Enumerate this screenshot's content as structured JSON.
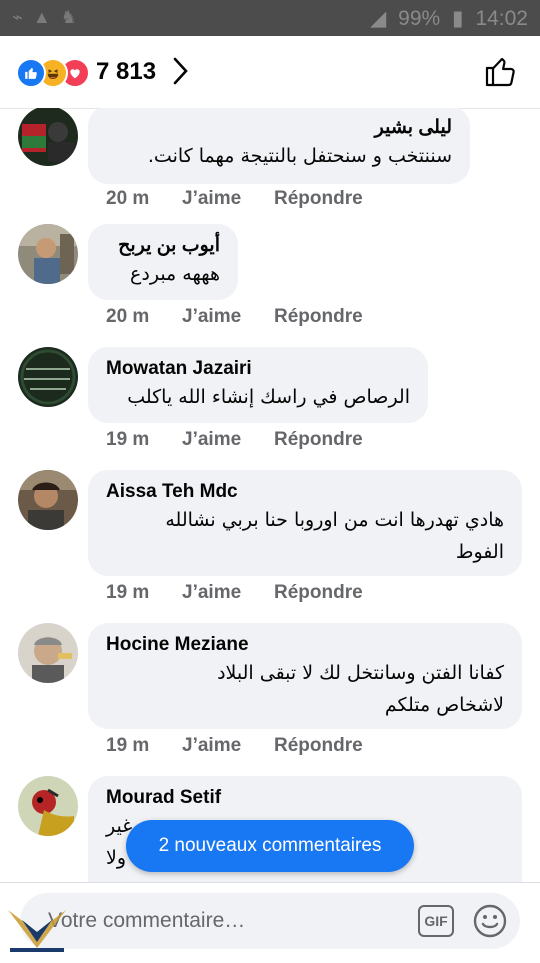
{
  "status_bar": {
    "battery_percent": "99%",
    "time": "14:02"
  },
  "header": {
    "reaction_count": "7 813",
    "reaction_icons": [
      "like-icon",
      "haha-icon",
      "love-icon"
    ]
  },
  "comments": [
    {
      "author": "ليلى بشير",
      "lines": [
        "سننتخب و سنحتفل بالنتيجة مهما كانت."
      ],
      "time": "20 m",
      "like": "J’aime",
      "reply": "Répondre"
    },
    {
      "author": "أيوب بن يربح",
      "lines": [
        "هههه مبردع"
      ],
      "time": "20 m",
      "like": "J’aime",
      "reply": "Répondre"
    },
    {
      "author": "Mowatan Jazairi",
      "lines": [
        "الرصاص في راسك إنشاء الله ياكلب"
      ],
      "time": "19 m",
      "like": "J’aime",
      "reply": "Répondre"
    },
    {
      "author": "Aissa Teh Mdc",
      "lines": [
        "هادي تهدرها انت من اوروبا حنا بربي نشالله",
        "الفوط"
      ],
      "time": "19 m",
      "like": "J’aime",
      "reply": "Répondre"
    },
    {
      "author": "Hocine Meziane",
      "lines": [
        "كفانا  الفتن وسانتخل لك لا تبقى البلاد",
        "لاشخاص متلكم"
      ],
      "time": "19 m",
      "like": "J’aime",
      "reply": "Répondre"
    },
    {
      "author": "Mourad Setif",
      "lines": [
        "تحوس. غير",
        "ترحك. ولا"
      ],
      "time": "",
      "like": "",
      "reply": ""
    }
  ],
  "new_comments_pill": "2 nouveaux commentaires",
  "composer": {
    "placeholder": "Votre commentaire…",
    "gif_label": "GIF"
  },
  "colors": {
    "accent": "#1877f2",
    "bubble": "#f0f2f5",
    "meta": "#65676b"
  }
}
